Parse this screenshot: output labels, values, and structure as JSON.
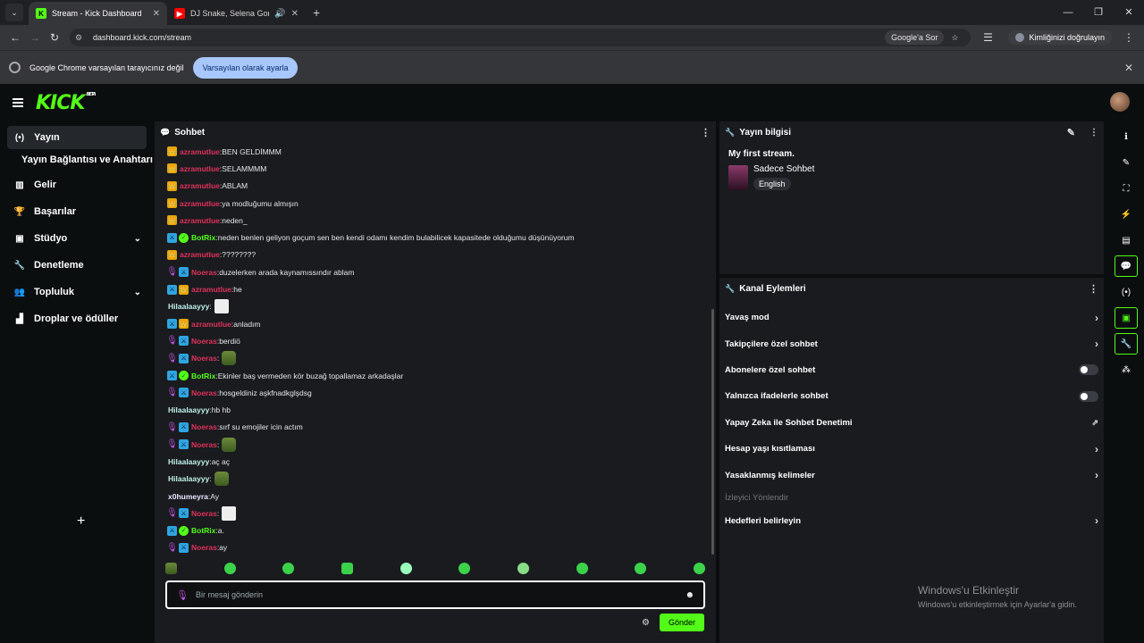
{
  "browser": {
    "tabs": [
      {
        "title": "Stream - Kick Dashboard",
        "active": true
      },
      {
        "title": "DJ Snake, Selena Gomez, O...",
        "active": false
      }
    ],
    "url": "dashboard.kick.com/stream",
    "google_sor": "Google'a Sor",
    "verify": "Kimliğinizi doğrulayın",
    "infobar_text": "Google Chrome varsayılan tarayıcınız değil",
    "infobar_button": "Varsayılan olarak ayarla"
  },
  "kick": {
    "logo": "KICK",
    "beta": "BETA"
  },
  "sidebar": {
    "items": [
      {
        "label": "Yayın",
        "icon": "(•)"
      },
      {
        "label": "Yayın Bağlantısı ve Anahtarı"
      },
      {
        "label": "Gelir",
        "icon": "▥"
      },
      {
        "label": "Başarılar",
        "icon": "🏆"
      },
      {
        "label": "Stüdyo",
        "icon": "▣"
      },
      {
        "label": "Denetleme",
        "icon": "🔧"
      },
      {
        "label": "Topluluk",
        "icon": "👥"
      },
      {
        "label": "Droplar ve ödüller",
        "icon": "▟"
      }
    ]
  },
  "chat": {
    "title": "Sohbet",
    "messages": [
      {
        "user": "azramutlue",
        "text": "BEN GELDİMMM"
      },
      {
        "user": "azramutlue",
        "text": "SELAMMMM"
      },
      {
        "user": "azramutlue",
        "text": "ABLAM"
      },
      {
        "user": "azramutlue",
        "text": "ya modluğumu almışın"
      },
      {
        "user": "azramutlue",
        "text": "neden_"
      },
      {
        "user": "BotRix",
        "text": "neden benlen geliyon goçum sen ben kendi odamı kendim bulabilicek kapasitede olduğumu düşünüyorum"
      },
      {
        "user": "azramutlue",
        "text": "????????"
      },
      {
        "user": "Noeras",
        "text": "duzelerken arada kaynamıssındır ablam"
      },
      {
        "user": "azramutlue",
        "text": "he"
      },
      {
        "user": "Hilaalaayyy",
        "text": ""
      },
      {
        "user": "azramutlue",
        "text": "anladım"
      },
      {
        "user": "Noeras",
        "text": "berdiö"
      },
      {
        "user": "Noeras",
        "text": ""
      },
      {
        "user": "BotRix",
        "text": "Ekinler baş vermeden kör buzağ topallamaz arkadaşlar"
      },
      {
        "user": "Noeras",
        "text": "hosgeldiniz aşkfnadkglşdsg"
      },
      {
        "user": "Hilaalaayyy",
        "text": "hb hb"
      },
      {
        "user": "Noeras",
        "text": "sırf su emojiler icin actım"
      },
      {
        "user": "Noeras",
        "text": ""
      },
      {
        "user": "Hilaalaayyy",
        "text": "aç aç"
      },
      {
        "user": "Hilaalaayyy",
        "text": ""
      },
      {
        "user": "x0humeyra",
        "text": "Ay"
      },
      {
        "user": "Noeras",
        "text": ""
      },
      {
        "user": "BotRix",
        "text": "a."
      },
      {
        "user": "Noeras",
        "text": "ay"
      }
    ],
    "placeholder": "Bir mesaj gönderin",
    "send": "Gönder"
  },
  "stream_info": {
    "title": "Yayın bilgisi",
    "stream_title": "My first stream.",
    "category": "Sadece Sohbet",
    "language": "English"
  },
  "channel_actions": {
    "title": "Kanal Eylemleri",
    "items": [
      "Yavaş mod",
      "Takipçilere özel sohbet",
      "Abonelere özel sohbet",
      "Yalnızca ifadelerle sohbet",
      "Yapay Zeka ile Sohbet Denetimi",
      "Hesap yaşı kısıtlaması",
      "Yasaklanmış kelimeler"
    ],
    "section": "İzleyici Yönlendir",
    "goals": "Hedefleri belirleyin"
  },
  "watermark": {
    "line1": "Windows'u Etkinleştir",
    "line2": "Windows'u etkinleştirmek için Ayarlar'a gidin."
  },
  "colors": {
    "accent": "#53fc18",
    "mod_name": "#e1315b"
  }
}
